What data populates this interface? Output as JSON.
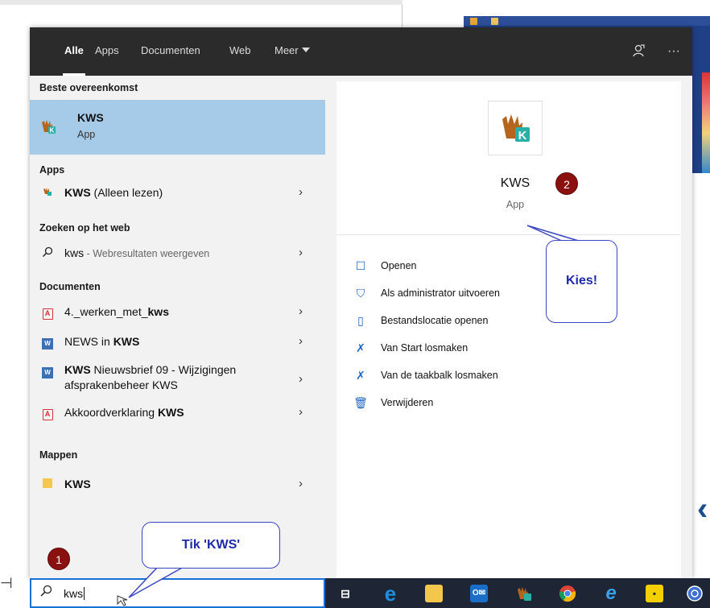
{
  "tabs": [
    {
      "label": "Alle",
      "active": true
    },
    {
      "label": "Apps"
    },
    {
      "label": "Documenten"
    },
    {
      "label": "Web"
    },
    {
      "label": "Meer"
    }
  ],
  "topbar_icons": [
    "feedback-icon",
    "more-options-icon"
  ],
  "more_label": "···",
  "sections": {
    "best_match": "Beste overeenkomst",
    "apps": "Apps",
    "web": "Zoeken op het web",
    "documents": "Documenten",
    "folders": "Mappen"
  },
  "best_match": {
    "title": "KWS",
    "subtitle": "App"
  },
  "apps": [
    {
      "bold": "KWS",
      "rest": " (Alleen lezen)"
    }
  ],
  "web": {
    "query": "kws",
    "suffix": " - Webresultaten weergeven"
  },
  "documents": [
    {
      "icon": "pdf-icon",
      "pre": "4._werken_met_",
      "bold": "kws",
      "post": ""
    },
    {
      "icon": "word-icon",
      "pre": "NEWS in ",
      "bold": "KWS",
      "post": ""
    },
    {
      "icon": "word-icon",
      "pre": "",
      "bold": "KWS",
      "post": " Nieuwsbrief 09 - Wijzigingen afsprakenbeheer KWS"
    },
    {
      "icon": "pdf-icon",
      "pre": "Akkoordverklaring ",
      "bold": "KWS",
      "post": ""
    }
  ],
  "folders": [
    {
      "label": "KWS"
    }
  ],
  "preview": {
    "title": "KWS",
    "subtitle": "App"
  },
  "actions": [
    {
      "icon": "open-icon",
      "label": "Openen"
    },
    {
      "icon": "admin-shield-icon",
      "label": "Als administrator uitvoeren"
    },
    {
      "icon": "file-location-icon",
      "label": "Bestandslocatie openen"
    },
    {
      "icon": "unpin-icon",
      "label": "Van Start losmaken"
    },
    {
      "icon": "unpin-icon",
      "label": "Van de taakbalk losmaken"
    },
    {
      "icon": "trash-icon",
      "label": "Verwijderen"
    }
  ],
  "search": {
    "value": "kws"
  },
  "annotations": {
    "badge1": "1",
    "badge2": "2",
    "callout1": "Tik 'KWS'",
    "callout2": "Kies!"
  },
  "colors": {
    "topbar": "#2b2b2b",
    "selected": "#a6cbe8",
    "accent": "#1672d6",
    "taskbar": "#1e2534",
    "badge": "#8b1010",
    "callout_text": "#1f2aa8"
  }
}
